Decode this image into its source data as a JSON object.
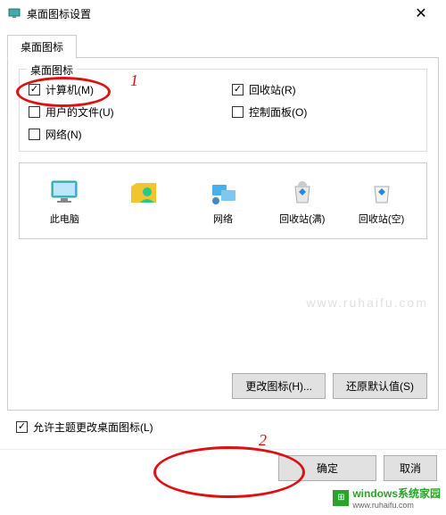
{
  "window": {
    "title": "桌面图标设置"
  },
  "tab": {
    "label": "桌面图标"
  },
  "group": {
    "title": "桌面图标",
    "checkboxes": [
      {
        "label": "计算机(M)",
        "checked": true
      },
      {
        "label": "回收站(R)",
        "checked": true
      },
      {
        "label": "用户的文件(U)",
        "checked": false
      },
      {
        "label": "控制面板(O)",
        "checked": false
      },
      {
        "label": "网络(N)",
        "checked": false
      }
    ]
  },
  "icons": [
    {
      "label": "此电脑"
    },
    {
      "label": ""
    },
    {
      "label": "网络"
    },
    {
      "label": "回收站(满)"
    },
    {
      "label": "回收站(空)"
    }
  ],
  "buttons": {
    "changeIcon": "更改图标(H)...",
    "restoreDefault": "还原默认值(S)"
  },
  "themeCheckbox": {
    "label": "允许主题更改桌面图标(L)",
    "checked": true
  },
  "dialogButtons": {
    "ok": "确定",
    "cancel": "取消"
  },
  "annotations": {
    "one": "1",
    "two": "2"
  },
  "watermark": {
    "text1": "windows系统家园",
    "text2": "www.ruhaifu.com",
    "faded": "www.ruhaifu.com"
  }
}
